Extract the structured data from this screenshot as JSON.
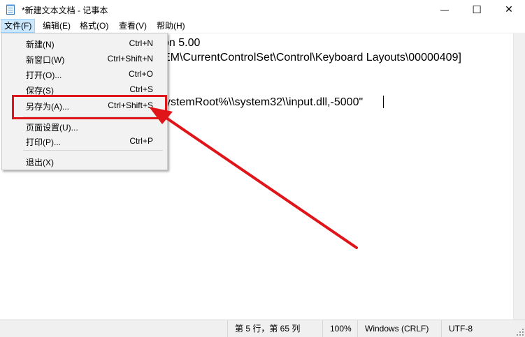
{
  "window": {
    "title": "*新建文本文档 - 记事本",
    "minimize_glyph": "—",
    "maximize_glyph": "☐",
    "close_glyph": "✕"
  },
  "menubar": {
    "items": [
      {
        "label": "文件(F)"
      },
      {
        "label": "编辑(E)"
      },
      {
        "label": "格式(O)"
      },
      {
        "label": "查看(V)"
      },
      {
        "label": "帮助(H)"
      }
    ]
  },
  "editor": {
    "lines": [
      "on 5.00",
      "EM\\CurrentControlSet\\Control\\Keyboard Layouts\\00000409]",
      "ystemRoot%\\\\system32\\\\input.dll,-5000\""
    ]
  },
  "file_menu": {
    "items": [
      {
        "label": "新建(N)",
        "shortcut": "Ctrl+N"
      },
      {
        "label": "新窗口(W)",
        "shortcut": "Ctrl+Shift+N"
      },
      {
        "label": "打开(O)...",
        "shortcut": "Ctrl+O"
      },
      {
        "label": "保存(S)",
        "shortcut": "Ctrl+S"
      },
      {
        "label": "另存为(A)...",
        "shortcut": "Ctrl+Shift+S"
      },
      {
        "label": "页面设置(U)...",
        "shortcut": ""
      },
      {
        "label": "打印(P)...",
        "shortcut": "Ctrl+P"
      },
      {
        "label": "退出(X)",
        "shortcut": ""
      }
    ]
  },
  "statusbar": {
    "position": "第 5 行，第 65 列",
    "zoom": "100%",
    "line_ending": "Windows (CRLF)",
    "encoding": "UTF-8"
  },
  "colors": {
    "annotation_red": "#e0151a",
    "menu_active_bg": "#cce8ff"
  }
}
